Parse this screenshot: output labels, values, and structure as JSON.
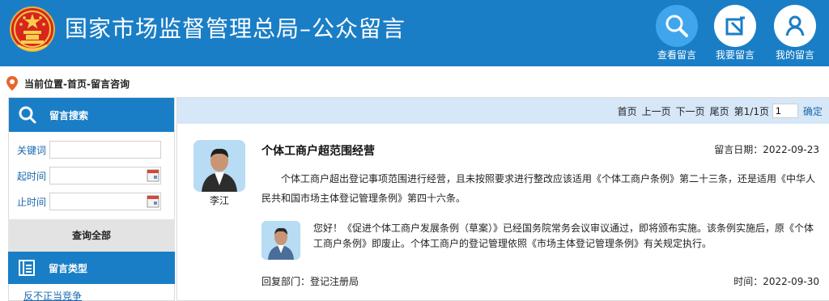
{
  "header": {
    "title": "国家市场监督管理总局–公众留言",
    "nav": [
      {
        "label": "查看留言",
        "icon": "search-icon"
      },
      {
        "label": "我要留言",
        "icon": "edit-icon"
      },
      {
        "label": "我的留言",
        "icon": "user-icon"
      }
    ],
    "colors": {
      "bar": "#1a7ec6",
      "active": "#3fa6ee"
    }
  },
  "breadcrumb": "当前位置-首页-留言咨询",
  "sidebar": {
    "search_title": "留言搜索",
    "keyword_label": "关键词",
    "keyword_value": "",
    "start_label": "起时间",
    "start_value": "",
    "end_label": "止时间",
    "end_value": "",
    "query_all": "查询全部",
    "category_title": "留言类型",
    "categories": [
      "反不正当竞争"
    ]
  },
  "pager": {
    "first": "首页",
    "prev": "上一页",
    "next": "下一页",
    "last": "尾页",
    "page_info": "第1/1页",
    "page_value": "1",
    "confirm": "确定"
  },
  "message": {
    "asker": "李江",
    "title": "个体工商户超范围经营",
    "date": "留言日期：2022-09-23",
    "body": "个体工商户超出登记事项范围进行经营，且未按照要求进行整改应该适用《个体工商户条例》第二十三条，还是适用《中华人民共和国市场主体登记管理条例》第四十六条。",
    "reply": "您好！《促进个体工商户发展条例（草案）》已经国务院常务会议审议通过，即将颁布实施。该条例实施后，原《个体工商户条例》即废止。个体工商户的登记管理依照《市场主体登记管理条例》有关规定执行。",
    "dept": "回复部门：登记注册局",
    "time": "时间：2022-09-30"
  }
}
